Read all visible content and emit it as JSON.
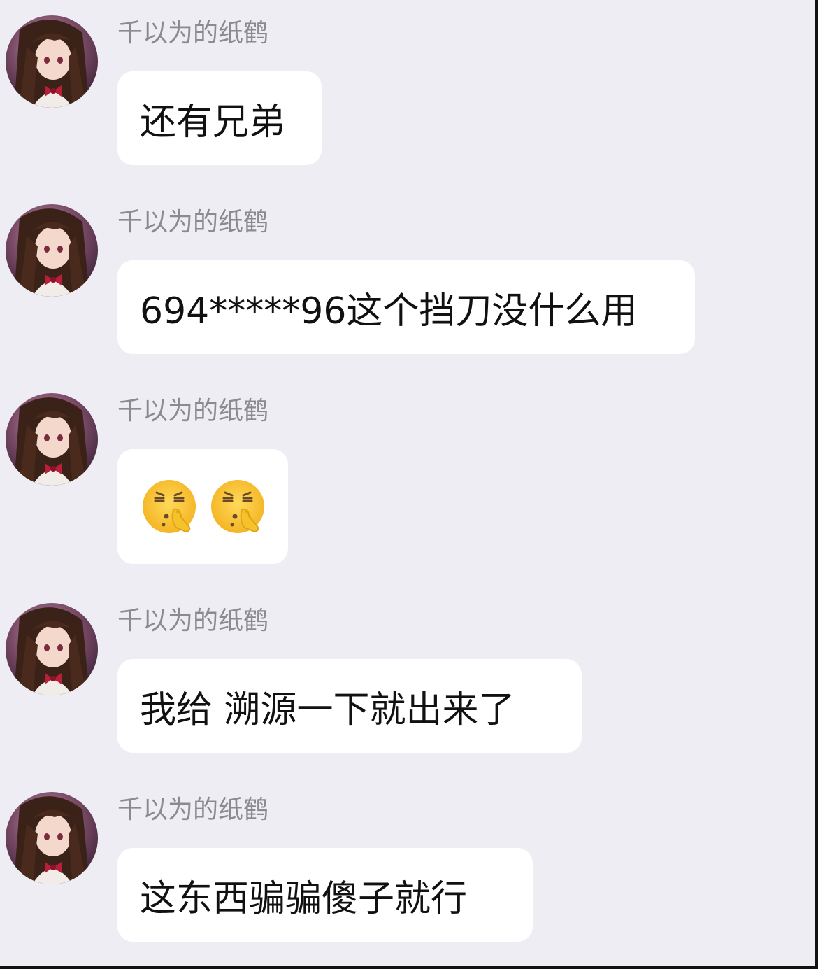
{
  "messages": [
    {
      "sender": "千以为的纸鹤",
      "text": "还有兄弟"
    },
    {
      "sender": "千以为的纸鹤",
      "text": "694*****96这个挡刀没什么用"
    },
    {
      "sender": "千以为的纸鹤",
      "emojis": [
        "shushing-face-emoji",
        "shushing-face-emoji"
      ]
    },
    {
      "sender": "千以为的纸鹤",
      "text": "我给 溯源一下就出来了"
    },
    {
      "sender": "千以为的纸鹤",
      "text": "这东西骗骗傻子就行"
    }
  ]
}
